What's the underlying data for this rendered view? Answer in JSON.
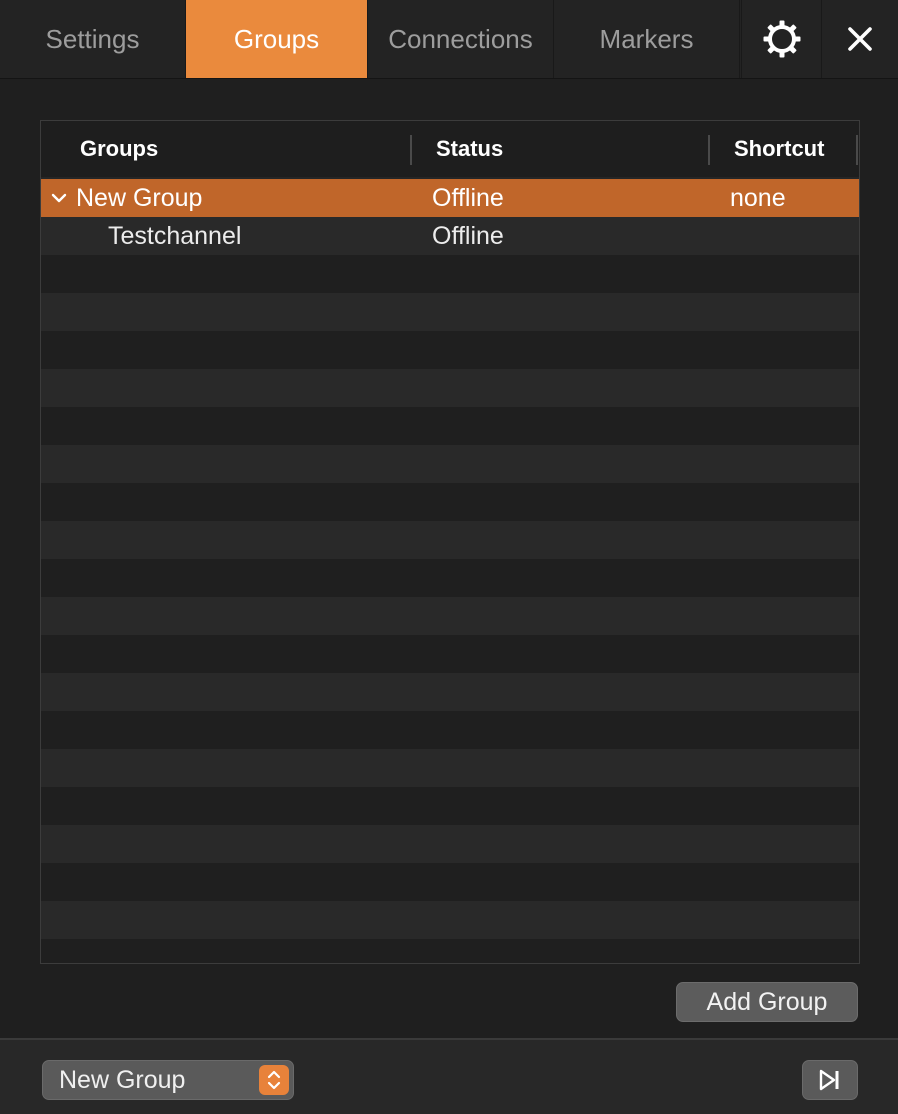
{
  "tabs": [
    {
      "label": "Settings",
      "active": false
    },
    {
      "label": "Groups",
      "active": true
    },
    {
      "label": "Connections",
      "active": false
    },
    {
      "label": "Markers",
      "active": false
    }
  ],
  "icons": {
    "settings": "gear-icon",
    "close": "close-icon",
    "expand": "chevron-down-icon",
    "stepper": "up-down-stepper-icon",
    "step_forward": "skip-forward-icon"
  },
  "colors": {
    "accent": "#ea8a3d",
    "selected_row": "#c0662a",
    "background": "#1f1f1f"
  },
  "table": {
    "columns": [
      "Groups",
      "Status",
      "Shortcut"
    ],
    "rows": [
      {
        "name": "New Group",
        "status": "Offline",
        "shortcut": "none",
        "expanded": true,
        "selected": true,
        "level": 0
      },
      {
        "name": "Testchannel",
        "status": "Offline",
        "shortcut": "",
        "expanded": false,
        "selected": false,
        "level": 1
      }
    ]
  },
  "actions": {
    "add_group_label": "Add Group"
  },
  "footer": {
    "group_select_value": "New Group"
  }
}
